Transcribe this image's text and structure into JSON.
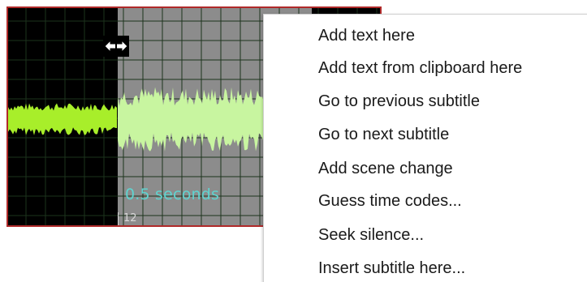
{
  "waveform": {
    "selection_duration_label": "0.5 seconds",
    "frame_marker_label": "12",
    "colors": {
      "background": "#000000",
      "selection_background": "#8c8c8c",
      "wave_unselected": "#a8ee2a",
      "wave_selected": "#c8f5a0",
      "grid": "#1f3a1f",
      "border": "#b02a2a",
      "selection_label": "#5fd4d0"
    },
    "cursor_icon": "horizontal-resize-icon"
  },
  "context_menu": {
    "items": [
      {
        "label": "Add text here"
      },
      {
        "label": "Add text from clipboard here"
      },
      {
        "label": "Go to previous subtitle"
      },
      {
        "label": "Go to next subtitle"
      },
      {
        "label": "Add scene change"
      },
      {
        "label": "Guess time codes..."
      },
      {
        "label": "Seek silence..."
      },
      {
        "label": "Insert subtitle here..."
      }
    ]
  }
}
